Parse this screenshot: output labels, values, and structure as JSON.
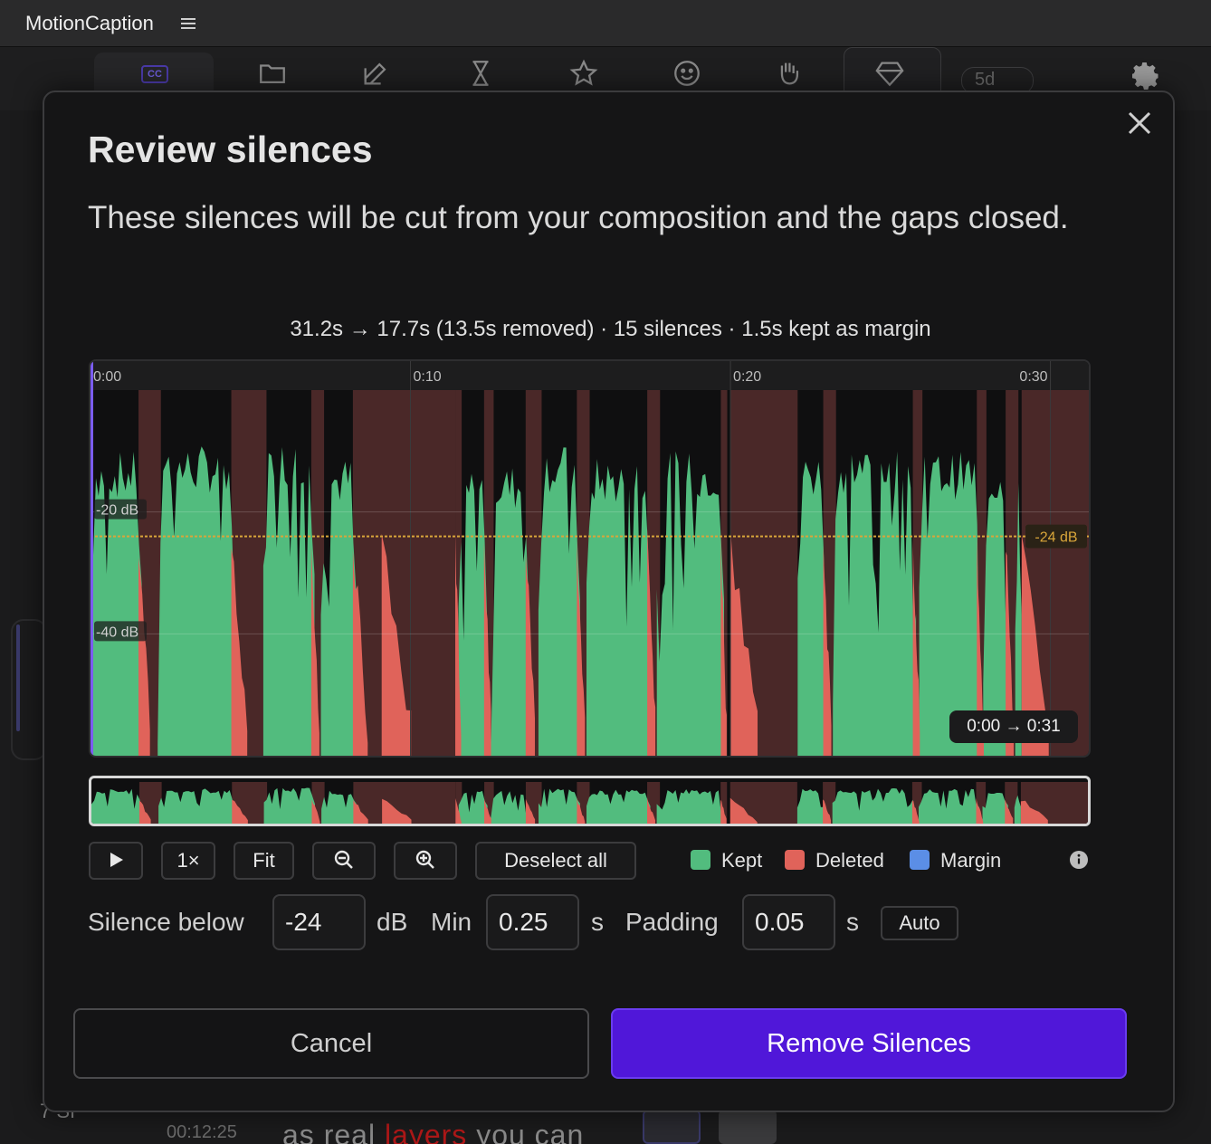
{
  "app": {
    "title": "MotionCaption",
    "toolbar_badge": "CC",
    "right_pill": "5d",
    "side_text": "s"
  },
  "background": {
    "row_index": "7",
    "row_code": "SI",
    "timecode": "00:12:25",
    "caption_words": [
      "as real ",
      "layers",
      " you can"
    ],
    "highlight_color": "#b01818"
  },
  "modal": {
    "title": "Review silences",
    "description": "These silences will be cut from your composition and the gaps closed.",
    "stats": "31.2s → 17.7s (13.5s removed) · 15 silences · 1.5s kept as margin",
    "range_label": "0:00 → 0:31",
    "controls": {
      "play_label": "▶",
      "speed_label": "1×",
      "fit_label": "Fit",
      "deselect_label": "Deselect all"
    },
    "legend": [
      {
        "label": "Kept",
        "color": "#52bc7e"
      },
      {
        "label": "Deleted",
        "color": "#e0635a"
      },
      {
        "label": "Margin",
        "color": "#5b8ee6"
      }
    ],
    "params": {
      "silence_label": "Silence below",
      "silence_value": "-24",
      "silence_unit": "dB",
      "min_label": "Min",
      "min_value": "0.25",
      "min_unit": "s",
      "padding_label": "Padding",
      "padding_value": "0.05",
      "padding_unit": "s",
      "auto_label": "Auto"
    },
    "cancel_label": "Cancel",
    "confirm_label": "Remove Silences"
  },
  "chart_data": {
    "type": "area",
    "xlim": [
      0,
      31.2
    ],
    "x_ticks": [
      "0:00",
      "0:10",
      "0:20",
      "0:30"
    ],
    "x_tick_values": [
      0,
      10,
      20,
      30
    ],
    "ylim": [
      -60,
      0
    ],
    "y_ticks": [
      "-20 dB",
      "-40 dB"
    ],
    "y_tick_values": [
      -20,
      -40
    ],
    "threshold_db": -24,
    "threshold_label": "-24 dB",
    "colors": {
      "kept": "#52bc7e",
      "deleted": "#e0635a",
      "silence_bg": "#4a2828",
      "margin": "#5b8ee6",
      "threshold": "#d9a63a"
    },
    "deleted_regions": [
      [
        1.5,
        2.2
      ],
      [
        4.4,
        5.5
      ],
      [
        6.9,
        7.3
      ],
      [
        8.2,
        9.2
      ],
      [
        9.1,
        11.4
      ],
      [
        11.4,
        11.6
      ],
      [
        12.3,
        12.6
      ],
      [
        13.6,
        14.1
      ],
      [
        15.2,
        15.6
      ],
      [
        17.4,
        17.8
      ],
      [
        19.7,
        19.9
      ],
      [
        20.0,
        22.1
      ],
      [
        22.9,
        23.3
      ],
      [
        25.7,
        26.0
      ],
      [
        27.7,
        28.0
      ],
      [
        28.6,
        29.0
      ],
      [
        29.1,
        31.2
      ]
    ],
    "speech_segments": [
      [
        0.0,
        1.6,
        -14
      ],
      [
        2.1,
        4.5,
        -13
      ],
      [
        5.4,
        7.0,
        -12
      ],
      [
        7.2,
        8.3,
        -15
      ],
      [
        11.5,
        12.4,
        -16
      ],
      [
        12.5,
        13.7,
        -16
      ],
      [
        14.0,
        15.3,
        -13
      ],
      [
        15.5,
        17.5,
        -15
      ],
      [
        17.7,
        19.8,
        -14
      ],
      [
        22.1,
        23.0,
        -14
      ],
      [
        23.2,
        25.8,
        -13
      ],
      [
        25.9,
        27.8,
        -14
      ],
      [
        27.9,
        28.7,
        -15
      ],
      [
        28.9,
        29.1,
        -18
      ]
    ]
  }
}
